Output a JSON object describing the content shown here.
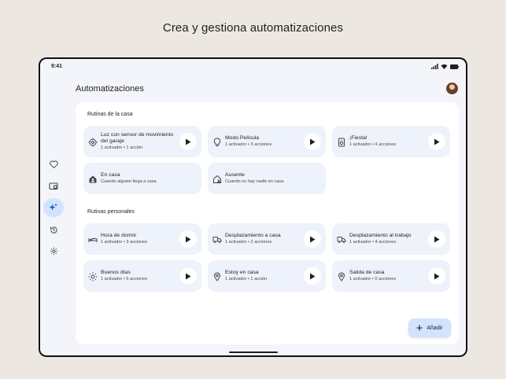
{
  "headline": "Crea y gestiona automatizaciones",
  "status_bar": {
    "time": "9:41"
  },
  "header": {
    "title": "Automatizaciones"
  },
  "nav_rail": [
    {
      "id": "favorites",
      "icon": "heart-icon",
      "active": false
    },
    {
      "id": "devices",
      "icon": "devices-icon",
      "active": false
    },
    {
      "id": "automations",
      "icon": "sparkle-icon",
      "active": true
    },
    {
      "id": "activity",
      "icon": "history-icon",
      "active": false
    },
    {
      "id": "settings",
      "icon": "gear-icon",
      "active": false
    }
  ],
  "home_routines": {
    "title": "Rutinas de la casa",
    "cards": [
      {
        "title": "Luz con sensor de movimiento del garaje",
        "subtitle": "1 activador • 1 acción",
        "icon": "motion-sensor-icon",
        "play": true
      },
      {
        "title": "Modo Película",
        "subtitle": "1 activador • 3 acciones",
        "icon": "lightbulb-icon",
        "play": true
      },
      {
        "title": "¡Fiesta!",
        "subtitle": "1 activador • 4 acciones",
        "icon": "speaker-icon",
        "play": true
      },
      {
        "title": "En casa",
        "subtitle": "Cuando alguien llega a casa",
        "icon": "home-person-icon",
        "play": false
      },
      {
        "title": "Ausente",
        "subtitle": "Cuando no hay nadie en casa",
        "icon": "home-away-icon",
        "play": false
      }
    ]
  },
  "personal_routines": {
    "title": "Rutinas personales",
    "cards": [
      {
        "title": "Hora de dormir",
        "subtitle": "1 activador • 3 acciones",
        "icon": "bed-icon",
        "play": true
      },
      {
        "title": "Desplazamiento a casa",
        "subtitle": "1 activador • 2 acciones",
        "icon": "commute-icon",
        "play": true
      },
      {
        "title": "Desplazamiento al trabajo",
        "subtitle": "1 activador • 4 acciones",
        "icon": "commute-icon",
        "play": true
      },
      {
        "title": "Buenos días",
        "subtitle": "1 activador • 5 acciones",
        "icon": "sun-icon",
        "play": true
      },
      {
        "title": "Estoy en casa",
        "subtitle": "1 activador • 1 acción",
        "icon": "location-pin-icon",
        "play": true
      },
      {
        "title": "Salida de casa",
        "subtitle": "1 activador • 0 acciones",
        "icon": "location-pin-icon",
        "play": true
      }
    ]
  },
  "fab": {
    "label": "Añadir",
    "icon": "plus-icon"
  },
  "colors": {
    "accent": "#d3e3fd",
    "card": "#eef2fa",
    "panel": "#ffffff",
    "background": "#f3f5fb"
  }
}
